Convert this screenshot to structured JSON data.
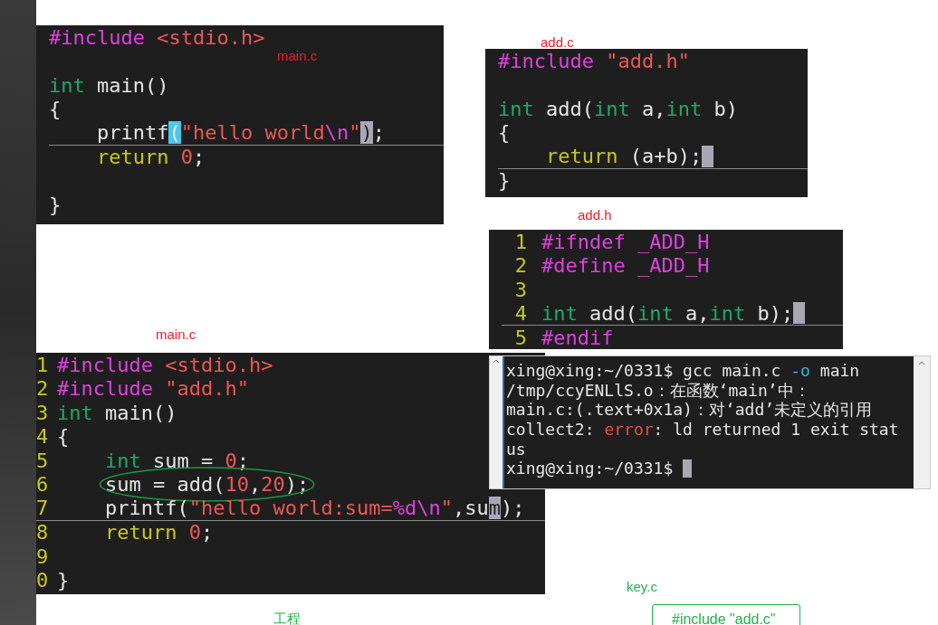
{
  "panels": [
    {
      "kind": "code",
      "caption": {
        "text": "main.c",
        "color": "#e8202a"
      },
      "lines": [
        {
          "kind": "code",
          "tokens": [
            {
              "kind": "pre",
              "text": "#include "
            },
            {
              "kind": "str",
              "text": "<stdio.h>"
            }
          ]
        },
        {
          "kind": "blank"
        },
        {
          "kind": "code",
          "tokens": [
            {
              "kind": "type",
              "text": "int"
            },
            {
              "kind": "plain",
              "text": " main()"
            }
          ]
        },
        {
          "kind": "code",
          "tokens": [
            {
              "kind": "plain",
              "text": "{"
            }
          ]
        },
        {
          "kind": "code",
          "cursorline": true,
          "tokens": [
            {
              "kind": "plain",
              "text": "    printf"
            },
            {
              "kind": "plain",
              "text": "(",
              "bracket_match": true
            },
            {
              "kind": "str",
              "text": "\"hello world"
            },
            {
              "kind": "pre",
              "text": "\\n"
            },
            {
              "kind": "str",
              "text": "\""
            },
            {
              "kind": "plain",
              "text": ")",
              "under_cursor": true
            },
            {
              "kind": "plain",
              "text": ";"
            }
          ]
        },
        {
          "kind": "code",
          "tokens": [
            {
              "kind": "kw",
              "text": "    return "
            },
            {
              "kind": "str",
              "text": "0"
            },
            {
              "kind": "plain",
              "text": ";"
            }
          ]
        },
        {
          "kind": "blank"
        },
        {
          "kind": "code",
          "tokens": [
            {
              "kind": "plain",
              "text": "}"
            }
          ]
        }
      ]
    },
    {
      "kind": "code",
      "caption": {
        "text": "add.c",
        "color": "#e8202a"
      },
      "lines": [
        {
          "kind": "code",
          "tokens": [
            {
              "kind": "pre",
              "text": "#include "
            },
            {
              "kind": "str",
              "text": "\"add.h\""
            }
          ]
        },
        {
          "kind": "blank"
        },
        {
          "kind": "code",
          "tokens": [
            {
              "kind": "type",
              "text": "int"
            },
            {
              "kind": "plain",
              "text": " add("
            },
            {
              "kind": "type",
              "text": "int"
            },
            {
              "kind": "plain",
              "text": " a,"
            },
            {
              "kind": "type",
              "text": "int"
            },
            {
              "kind": "plain",
              "text": " b)"
            }
          ]
        },
        {
          "kind": "code",
          "tokens": [
            {
              "kind": "plain",
              "text": "{"
            }
          ]
        },
        {
          "kind": "code",
          "cursorline": true,
          "cursor": true,
          "tokens": [
            {
              "kind": "kw",
              "text": "    return"
            },
            {
              "kind": "plain",
              "text": " (a+b);"
            }
          ]
        },
        {
          "kind": "code",
          "tokens": [
            {
              "kind": "plain",
              "text": "}"
            }
          ]
        }
      ]
    },
    {
      "kind": "code",
      "caption": {
        "text": "add.h",
        "color": "#e8202a"
      },
      "lines": [
        {
          "kind": "code",
          "number": "1",
          "tokens": [
            {
              "kind": "pre",
              "text": "#ifndef _ADD_H"
            }
          ]
        },
        {
          "kind": "code",
          "number": "2",
          "tokens": [
            {
              "kind": "pre",
              "text": "#define _ADD_H"
            }
          ]
        },
        {
          "kind": "code",
          "number": "3"
        },
        {
          "kind": "code",
          "number": "4",
          "cursorline": true,
          "cursor": true,
          "tokens": [
            {
              "kind": "type",
              "text": "int"
            },
            {
              "kind": "plain",
              "text": " add("
            },
            {
              "kind": "type",
              "text": "int"
            },
            {
              "kind": "plain",
              "text": " a,"
            },
            {
              "kind": "type",
              "text": "int"
            },
            {
              "kind": "plain",
              "text": " b);"
            }
          ]
        },
        {
          "kind": "code",
          "number": "5",
          "tokens": [
            {
              "kind": "pre",
              "text": "#endif"
            }
          ]
        }
      ]
    },
    {
      "kind": "code",
      "caption": {
        "text": "main.c",
        "color": "#e8202a"
      },
      "lines": [
        {
          "kind": "code",
          "number": "1",
          "tokens": [
            {
              "kind": "pre",
              "text": "#include "
            },
            {
              "kind": "str",
              "text": "<stdio.h>"
            }
          ]
        },
        {
          "kind": "code",
          "number": "2",
          "tokens": [
            {
              "kind": "pre",
              "text": "#include "
            },
            {
              "kind": "str",
              "text": "\"add.h\""
            }
          ]
        },
        {
          "kind": "code",
          "number": "3",
          "tokens": [
            {
              "kind": "type",
              "text": "int"
            },
            {
              "kind": "plain",
              "text": " main()"
            }
          ]
        },
        {
          "kind": "code",
          "number": "4",
          "tokens": [
            {
              "kind": "plain",
              "text": "{"
            }
          ]
        },
        {
          "kind": "code",
          "number": "5",
          "tokens": [
            {
              "kind": "type",
              "text": "    int"
            },
            {
              "kind": "plain",
              "text": " sum = "
            },
            {
              "kind": "str",
              "text": "0"
            },
            {
              "kind": "plain",
              "text": ";"
            }
          ]
        },
        {
          "kind": "code",
          "number": "6",
          "circled": true,
          "tokens": [
            {
              "kind": "plain",
              "text": "    sum = add("
            },
            {
              "kind": "str",
              "text": "10"
            },
            {
              "kind": "plain",
              "text": ","
            },
            {
              "kind": "str",
              "text": "20"
            },
            {
              "kind": "plain",
              "text": ");"
            }
          ]
        },
        {
          "kind": "code",
          "number": "7",
          "cursorline": true,
          "tokens": [
            {
              "kind": "plain",
              "text": "    printf("
            },
            {
              "kind": "str",
              "text": "\"hello world:sum="
            },
            {
              "kind": "pre",
              "text": "%d\\n"
            },
            {
              "kind": "str",
              "text": "\""
            },
            {
              "kind": "plain",
              "text": ",su"
            },
            {
              "kind": "plain",
              "text": "m",
              "under_cursor": true
            },
            {
              "kind": "plain",
              "text": ");"
            }
          ]
        },
        {
          "kind": "code",
          "number": "8",
          "tokens": [
            {
              "kind": "kw",
              "text": "    return "
            },
            {
              "kind": "str",
              "text": "0"
            },
            {
              "kind": "plain",
              "text": ";"
            }
          ]
        },
        {
          "kind": "code",
          "number": "9"
        },
        {
          "kind": "code",
          "number": "0",
          "tokens": [
            {
              "kind": "plain",
              "text": "}"
            }
          ]
        }
      ]
    },
    {
      "kind": "terminal",
      "lines": [
        {
          "kind": "code",
          "tokens": [
            {
              "kind": "plain",
              "text": "xing@xing:~/0331$ gcc main.c "
            },
            {
              "kind": "opt",
              "text": "-o"
            },
            {
              "kind": "plain",
              "text": " main"
            }
          ]
        },
        {
          "kind": "code",
          "tokens": [
            {
              "kind": "plain",
              "text": "/tmp/ccyENLlS.o：在函数‘main’中："
            }
          ]
        },
        {
          "kind": "code",
          "tokens": [
            {
              "kind": "plain",
              "text": "main.c:(.text+0x1a)：对‘add’未定义的引用"
            }
          ]
        },
        {
          "kind": "code",
          "tokens": [
            {
              "kind": "plain",
              "text": "collect2: "
            },
            {
              "kind": "err",
              "text": "error"
            },
            {
              "kind": "plain",
              "text": ": ld returned 1 exit stat"
            }
          ]
        },
        {
          "kind": "code",
          "tokens": [
            {
              "kind": "plain",
              "text": "us"
            }
          ]
        },
        {
          "kind": "code",
          "cursor": true,
          "tokens": [
            {
              "kind": "plain",
              "text": "xing@xing:~/0331$ "
            }
          ]
        }
      ]
    },
    {
      "kind": "label",
      "caption": {
        "text": "工程",
        "color": "#22b14c"
      }
    },
    {
      "kind": "note",
      "caption": {
        "text": "key.c",
        "color": "#22b14c"
      },
      "text": "#include \"add.c\""
    }
  ]
}
